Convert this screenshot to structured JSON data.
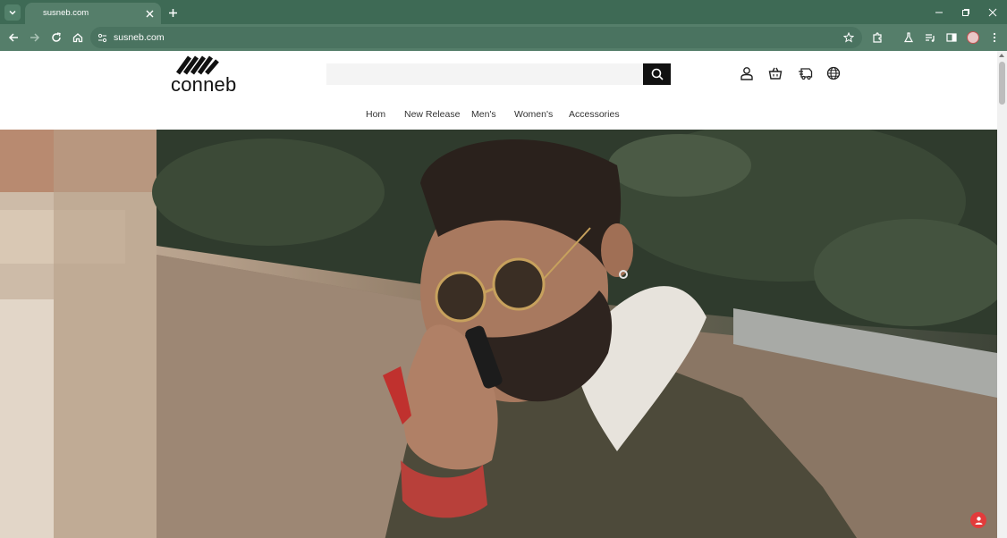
{
  "browser": {
    "tab_title": "susneb.com",
    "url": "susneb.com"
  },
  "site": {
    "logo_text": "conneb",
    "search": {
      "placeholder": "",
      "value": ""
    },
    "nav": [
      {
        "label": "Hom"
      },
      {
        "label": "New Release"
      },
      {
        "label": "Men's"
      },
      {
        "label": "Women's"
      },
      {
        "label": "Accessories"
      }
    ]
  },
  "colors": {
    "chrome_tabstrip": "#3e6a55",
    "chrome_toolbar": "#557e6a",
    "page_bg": "#ffffff",
    "search_button": "#111111",
    "badge": "#e23b3b"
  },
  "icons": {
    "header": [
      "user-icon",
      "shopping-basket-icon",
      "delivery-truck-icon",
      "globe-icon"
    ]
  }
}
